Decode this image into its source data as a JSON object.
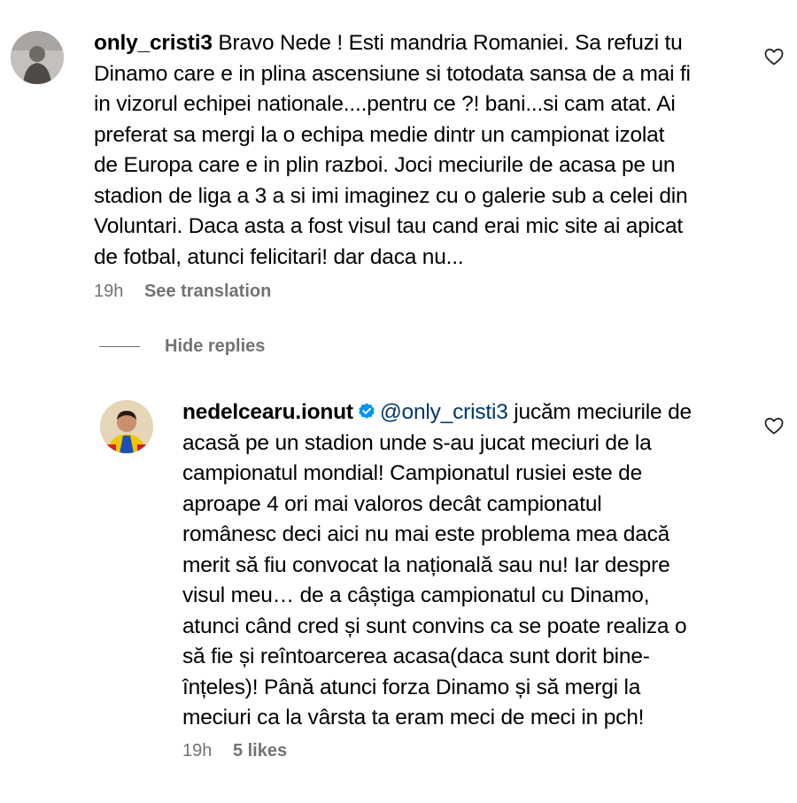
{
  "comment": {
    "username": "only_cristi3",
    "lines": [
      "Bravo Nede ! Esti mandria Romaniei. Sa refuzi tu",
      "Dinamo care e in plina ascensiune si totodata sansa de a mai fi",
      "in vizorul echipei nationale....pentru ce ?! bani...si cam atat. Ai",
      "preferat sa mergi la o echipa medie dintr un campionat izolat",
      "de Europa care e in plin razboi. Joci meciurile de acasa pe un",
      "stadion de liga a 3 a si imi imaginez cu o galerie sub a celei din",
      "Voluntari. Daca asta a fost visul tau cand erai mic site ai apicat",
      "de fotbal, atunci felicitari! dar daca nu..."
    ],
    "time": "19h",
    "see_translation": "See translation"
  },
  "hide_replies": "Hide replies",
  "reply": {
    "username": "nedelcearu.ionut",
    "mention": "@only_cristi3",
    "first_line_rest": " jucăm meciurile de",
    "lines": [
      "acasă pe un stadion unde s-au jucat meciuri de la",
      "campionatul mondial! Campionatul rusiei este de",
      "aproape 4 ori mai valoros decât campionatul",
      "românesc deci aici nu mai este problema mea dacă",
      "merit să fiu convocat la națională sau nu! Iar despre",
      "visul meu… de a câștiga campionatul cu Dinamo,",
      "atunci când cred și sunt convins ca se poate realiza o",
      "să fie și reîntoarcerea acasa(daca sunt dorit bine-",
      "înțeles)! Până atunci forza Dinamo și să mergi la",
      "meciuri ca la vârsta ta eram meci de meci in pch!"
    ],
    "time": "19h",
    "likes": "5 likes"
  },
  "colors": {
    "muted": "#737373",
    "mention": "#00376b",
    "verified": "#0095f6"
  }
}
